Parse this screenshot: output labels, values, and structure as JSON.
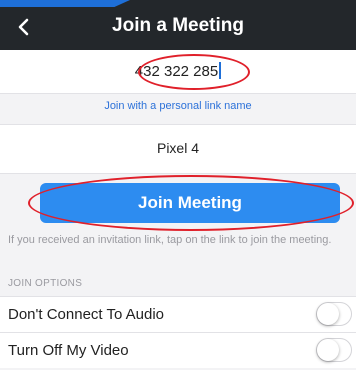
{
  "nav": {
    "title": "Join a Meeting",
    "back_icon": "chevron-left-icon"
  },
  "meeting": {
    "id_value": "432 322 285"
  },
  "personal_link": "Join with a personal link name",
  "display_name": "Pixel 4",
  "join_button": "Join Meeting",
  "hint": "If you received an invitation link, tap on the link to join the meeting.",
  "options": {
    "section_label": "JOIN OPTIONS",
    "items": [
      {
        "label": "Don't Connect To Audio",
        "enabled": false
      },
      {
        "label": "Turn Off My Video",
        "enabled": false
      }
    ]
  },
  "colors": {
    "navbar": "#23272b",
    "accent": "#2d8cf0",
    "annotation": "#e0202a"
  }
}
